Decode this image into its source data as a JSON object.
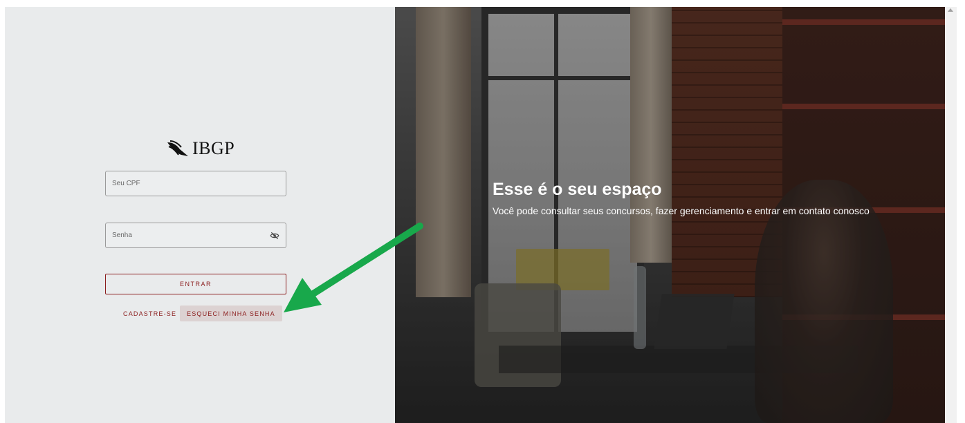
{
  "logo": {
    "text": "IBGP",
    "icon": "bird-wing-icon"
  },
  "login": {
    "cpf_placeholder": "Seu CPF",
    "password_placeholder": "Senha",
    "enter_label": "ENTRAR",
    "register_label": "CADASTRE-SE",
    "forgot_label": "ESQUECI MINHA SENHA",
    "eye_icon": "eye-off-icon"
  },
  "hero": {
    "title": "Esse é o seu espaço",
    "subtitle": "Você pode consultar seus concursos, fazer gerenciamento e entrar em contato conosco"
  },
  "colors": {
    "left_bg": "#e9ebec",
    "brand": "#8b1d1d",
    "forgot_bg": "#dcd2d2",
    "arrow": "#18a84b"
  }
}
